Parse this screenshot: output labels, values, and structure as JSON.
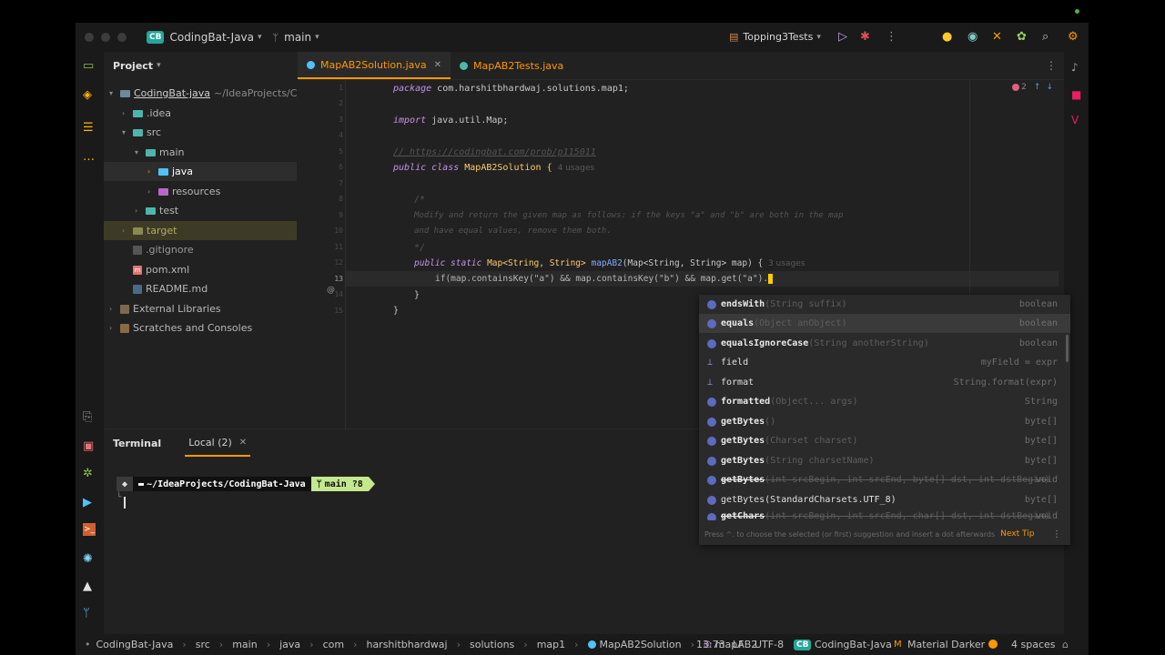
{
  "titlebar": {
    "project_badge": "CB",
    "project_name": "CodingBat-Java",
    "branch": "main",
    "run_config": "Topping3Tests"
  },
  "project_panel": {
    "title": "Project",
    "tree": [
      {
        "label": "CodingBat-java",
        "extra": "~/IdeaProjects/Coc"
      },
      {
        "label": ".idea"
      },
      {
        "label": "src"
      },
      {
        "label": "main"
      },
      {
        "label": "java"
      },
      {
        "label": "resources"
      },
      {
        "label": "test"
      },
      {
        "label": "target"
      },
      {
        "label": ".gitignore"
      },
      {
        "label": "pom.xml"
      },
      {
        "label": "README.md"
      },
      {
        "label": "External Libraries"
      },
      {
        "label": "Scratches and Consoles"
      }
    ]
  },
  "editor": {
    "tabs": [
      {
        "label": "MapAB2Solution.java"
      },
      {
        "label": "MapAB2Tests.java"
      }
    ],
    "problems_count": "2",
    "line_numbers": [
      "1",
      "2",
      "3",
      "4",
      "5",
      "6",
      "7",
      "8",
      "9",
      "10",
      "11",
      "12",
      "13",
      "14",
      "15"
    ],
    "code": {
      "l1_kw": "package",
      "l1_rest": " com.harshitbhardwaj.solutions.map1;",
      "l3_kw": "import",
      "l3_rest": " java.util.Map;",
      "l5": "// https://codingbat.com/prob/p115011",
      "l6_kw": "public class",
      "l6_rest": " MapAB2Solution {",
      "l6_hint": "4 usages",
      "l8": "/*",
      "l9": "Modify and return the given map as follows: if the keys \"a\" and \"b\" are both in the map",
      "l10": "and have equal values, remove them both.",
      "l11": "*/",
      "l12_kw": "public static",
      "l12_t1": " Map<String, String>",
      "l12_fn": " mapAB2",
      "l12_rest": "(Map<String, String> map) {",
      "l12_hint": "3 usages",
      "l13": "if(map.containsKey(\"a\") && map.containsKey(\"b\") && map.get(\"a\").",
      "l14": "}",
      "l15": "}"
    }
  },
  "completion": {
    "items": [
      {
        "name": "endsWith",
        "sig": "(String suffix)",
        "ret": "boolean"
      },
      {
        "name": "equals",
        "sig": "(Object anObject)",
        "ret": "boolean"
      },
      {
        "name": "equalsIgnoreCase",
        "sig": "(String anotherString)",
        "ret": "boolean"
      },
      {
        "name": "field",
        "sig": "",
        "ret": "myField = expr"
      },
      {
        "name": "format",
        "sig": "",
        "ret": "String.format(expr)"
      },
      {
        "name": "formatted",
        "sig": "(Object... args)",
        "ret": "String"
      },
      {
        "name": "getBytes",
        "sig": "()",
        "ret": "byte[]"
      },
      {
        "name": "getBytes",
        "sig": "(Charset charset)",
        "ret": "byte[]"
      },
      {
        "name": "getBytes",
        "sig": "(String charsetName)",
        "ret": "byte[]"
      },
      {
        "name": "getBytes",
        "sig": "(int srcBegin, int srcEnd, byte[] dst, int dstBegin)",
        "ret": "void"
      },
      {
        "name": "getBytes(StandardCharsets.UTF_8)",
        "sig": "",
        "ret": "byte[]"
      },
      {
        "name": "getChars",
        "sig": "(int srcBegin, int srcEnd, char[] dst, int dstBegin)",
        "ret": "void"
      }
    ],
    "footer": "Press ^. to choose the selected (or first) suggestion and insert a dot afterwards",
    "next_tip": "Next Tip"
  },
  "terminal": {
    "tab_title": "Terminal",
    "session": "Local (2)",
    "path": "~/IdeaProjects/CodingBat-Java",
    "branch": "main ?8"
  },
  "statusbar": {
    "breadcrumbs": [
      "CodingBat-Java",
      "src",
      "main",
      "java",
      "com",
      "harshitbhardwaj",
      "solutions",
      "map1",
      "MapAB2Solution",
      "mapAB2"
    ],
    "position": "13:73",
    "line_sep": "LF",
    "encoding": "UTF-8",
    "project_badge": "CB",
    "project_name": "CodingBat-Java",
    "theme": "Material Darker",
    "indent": "4 spaces"
  },
  "colors": {
    "accent": "#ff9800",
    "badge": "#26a69a",
    "folder": "#4db6ac",
    "class_icon": "#4fc3f7",
    "branch_seg": "#c3e88d"
  }
}
